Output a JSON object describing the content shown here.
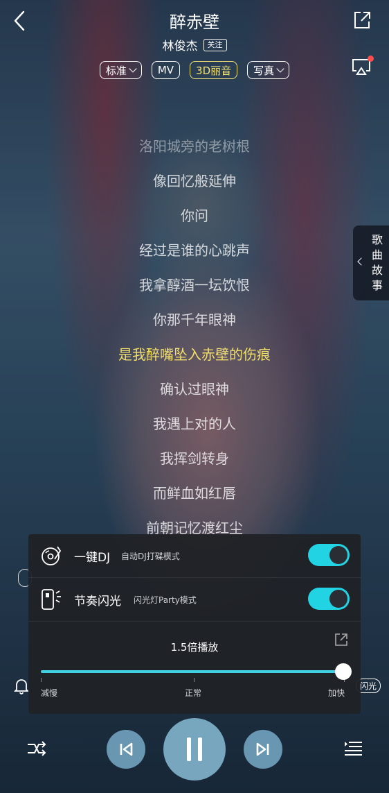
{
  "header": {
    "title": "醉赤壁",
    "artist": "林俊杰",
    "follow_label": "关注"
  },
  "chips": [
    {
      "label": "标准",
      "dropdown": true
    },
    {
      "label": "MV",
      "dropdown": false
    },
    {
      "label": "3D丽音",
      "dropdown": false,
      "highlight": true
    },
    {
      "label": "写真",
      "dropdown": true
    }
  ],
  "lyrics": [
    {
      "text": "洛阳城旁的老树根",
      "state": "dim"
    },
    {
      "text": "像回忆般延伸",
      "state": "normal"
    },
    {
      "text": "你问",
      "state": "normal"
    },
    {
      "text": "经过是谁的心跳声",
      "state": "normal"
    },
    {
      "text": "我拿醇酒一坛饮恨",
      "state": "normal"
    },
    {
      "text": "你那千年眼神",
      "state": "normal"
    },
    {
      "text": "是我醉嘴坠入赤壁的伤痕",
      "state": "active"
    },
    {
      "text": "确认过眼神",
      "state": "normal"
    },
    {
      "text": "我遇上对的人",
      "state": "normal"
    },
    {
      "text": "我挥剑转身",
      "state": "normal"
    },
    {
      "text": "而鲜血如红唇",
      "state": "normal"
    },
    {
      "text": "前朝记忆渡红尘",
      "state": "normal"
    }
  ],
  "song_story": {
    "label": "歌曲故事"
  },
  "bottom_tags": {
    "flash": "闪光"
  },
  "panel": {
    "dj": {
      "name": "一键DJ",
      "desc": "自动DJ打碟模式",
      "enabled": true
    },
    "flash": {
      "name": "节奏闪光",
      "desc": "闪光灯Party模式",
      "enabled": true
    },
    "speed": {
      "title": "1.5倍播放",
      "value": 1.5,
      "labels": {
        "slow": "减慢",
        "normal": "正常",
        "fast": "加快"
      }
    }
  },
  "colors": {
    "accent": "#22d3e4",
    "active_lyric": "#f1df6c",
    "chip_highlight": "#f4e27a"
  },
  "controls": {
    "state": "playing"
  }
}
